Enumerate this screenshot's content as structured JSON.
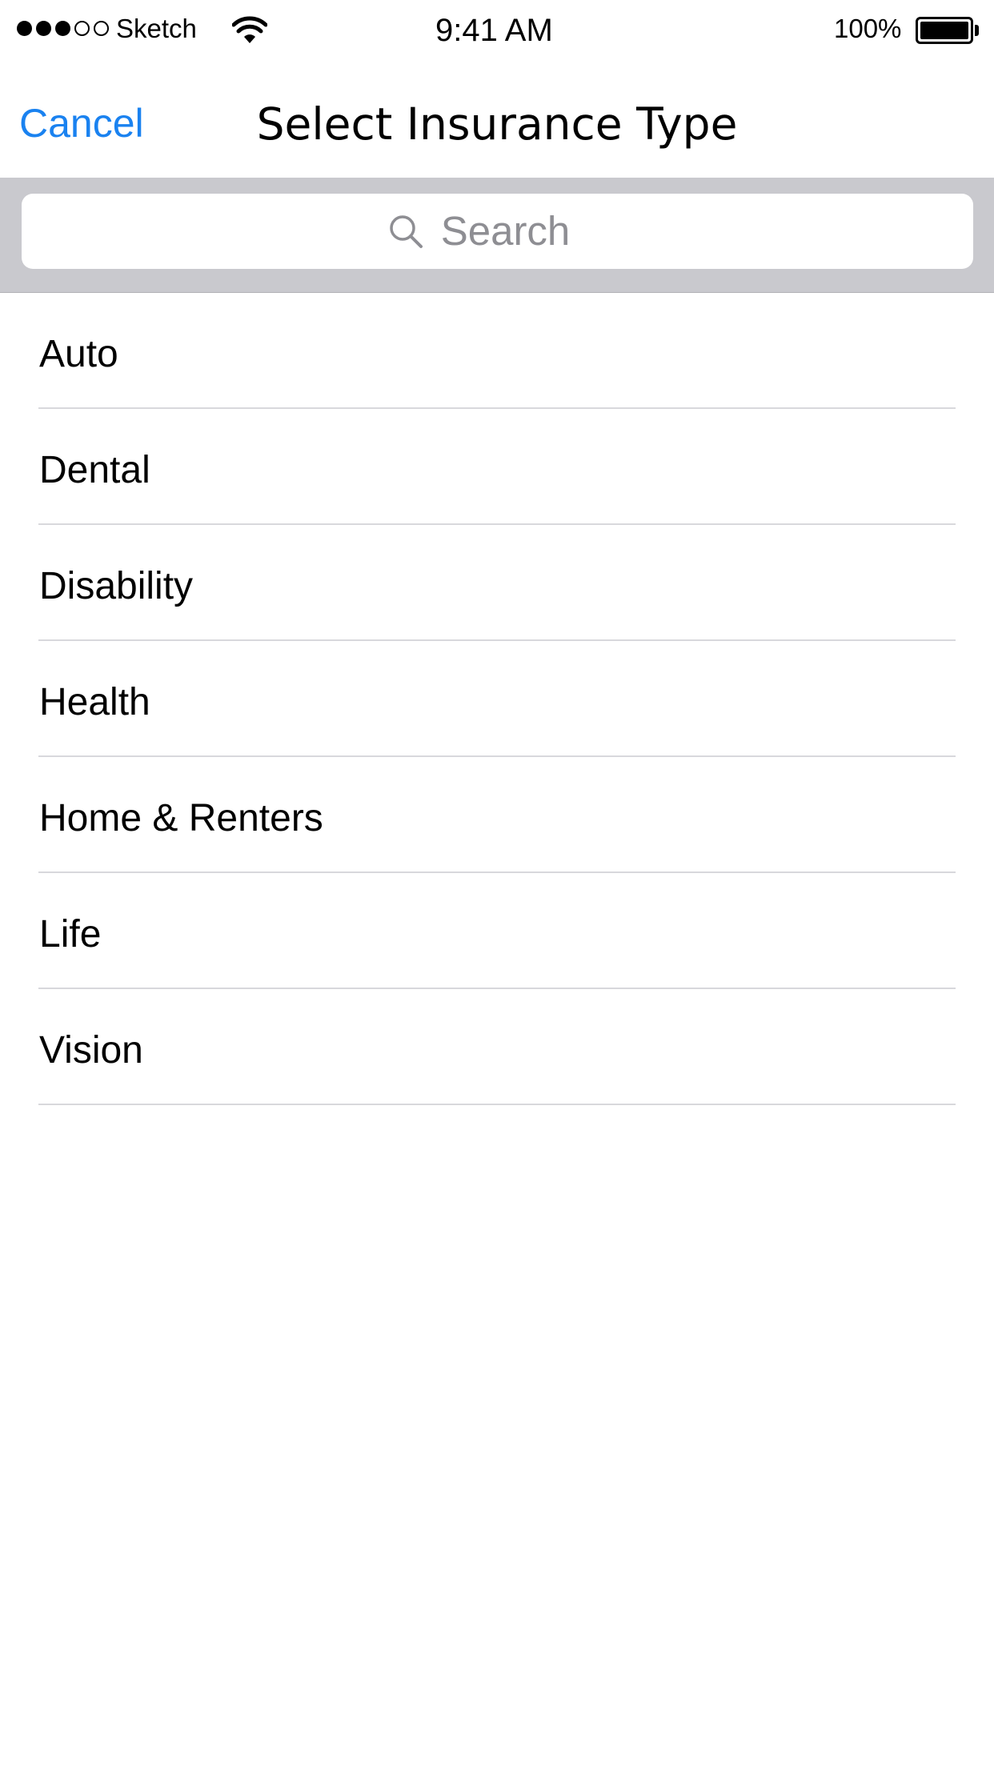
{
  "status_bar": {
    "carrier": "Sketch",
    "time": "9:41 AM",
    "battery_percent": "100%",
    "signal_bars_filled": 3,
    "signal_bars_total": 5,
    "battery_level": 1.0
  },
  "nav_bar": {
    "cancel_label": "Cancel",
    "title": "Select Insurance Type",
    "accent_color": "#1a82f0"
  },
  "search": {
    "placeholder": "Search",
    "icon": "search-icon"
  },
  "list": {
    "items": [
      {
        "label": "Auto"
      },
      {
        "label": "Dental"
      },
      {
        "label": "Disability"
      },
      {
        "label": "Health"
      },
      {
        "label": "Home & Renters"
      },
      {
        "label": "Life"
      },
      {
        "label": "Vision"
      }
    ]
  }
}
